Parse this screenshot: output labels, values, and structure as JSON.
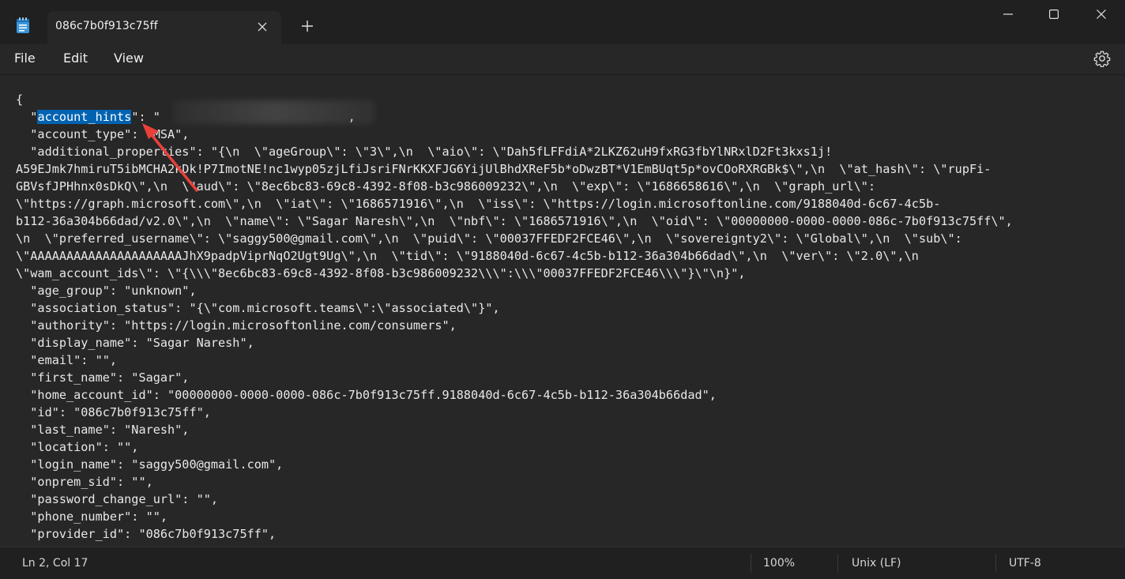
{
  "tab": {
    "title": "086c7b0f913c75ff"
  },
  "menu": [
    "File",
    "Edit",
    "View"
  ],
  "editor": {
    "line1": "{",
    "line2_pre": "  \"",
    "line2_sel": "account_hints",
    "line2_post": "\": \"                          ,",
    "lines": [
      "  \"account_type\": \"MSA\",",
      "  \"additional_properties\": \"{\\n  \\\"ageGroup\\\": \\\"3\\\",\\n  \\\"aio\\\": \\\"Dah5fLFFdiA*2LKZ62uH9fxRG3fbYlNRxlD2Ft3kxs1j!",
      "A59EJmk7hmiruT5ibMCHA2kDk!P7ImotNE!nc1wyp05zjLfiJsriFNrKKXFJG6YijUlBhdXReF5b*oDwzBT*V1EmBUqt5p*ovCOoRXRGBk$\\\",\\n  \\\"at_hash\\\": \\\"rupFi-",
      "GBVsfJPHhnx0sDkQ\\\",\\n  \\\"aud\\\": \\\"8ec6bc83-69c8-4392-8f08-b3c986009232\\\",\\n  \\\"exp\\\": \\\"1686658616\\\",\\n  \\\"graph_url\\\":",
      "\\\"https://graph.microsoft.com\\\",\\n  \\\"iat\\\": \\\"1686571916\\\",\\n  \\\"iss\\\": \\\"https://login.microsoftonline.com/9188040d-6c67-4c5b-",
      "b112-36a304b66dad/v2.0\\\",\\n  \\\"name\\\": \\\"Sagar Naresh\\\",\\n  \\\"nbf\\\": \\\"1686571916\\\",\\n  \\\"oid\\\": \\\"00000000-0000-0000-086c-7b0f913c75ff\\\",",
      "\\n  \\\"preferred_username\\\": \\\"saggy500@gmail.com\\\",\\n  \\\"puid\\\": \\\"00037FFEDF2FCE46\\\",\\n  \\\"sovereignty2\\\": \\\"Global\\\",\\n  \\\"sub\\\":",
      "\\\"AAAAAAAAAAAAAAAAAAAAAJhX9padpViprNqO2Ugt9Ug\\\",\\n  \\\"tid\\\": \\\"9188040d-6c67-4c5b-b112-36a304b66dad\\\",\\n  \\\"ver\\\": \\\"2.0\\\",\\n",
      "\\\"wam_account_ids\\\": \\\"{\\\\\\\"8ec6bc83-69c8-4392-8f08-b3c986009232\\\\\\\":\\\\\\\"00037FFEDF2FCE46\\\\\\\"}\\\"\\n}\",",
      "  \"age_group\": \"unknown\",",
      "  \"association_status\": \"{\\\"com.microsoft.teams\\\":\\\"associated\\\"}\",",
      "  \"authority\": \"https://login.microsoftonline.com/consumers\",",
      "  \"display_name\": \"Sagar Naresh\",",
      "  \"email\": \"\",",
      "  \"first_name\": \"Sagar\",",
      "  \"home_account_id\": \"00000000-0000-0000-086c-7b0f913c75ff.9188040d-6c67-4c5b-b112-36a304b66dad\",",
      "  \"id\": \"086c7b0f913c75ff\",",
      "  \"last_name\": \"Naresh\",",
      "  \"location\": \"\",",
      "  \"login_name\": \"saggy500@gmail.com\",",
      "  \"onprem_sid\": \"\",",
      "  \"password_change_url\": \"\",",
      "  \"phone_number\": \"\",",
      "  \"provider_id\": \"086c7b0f913c75ff\","
    ]
  },
  "status": {
    "position": "Ln 2, Col 17",
    "zoom": "100%",
    "line_ending": "Unix (LF)",
    "encoding": "UTF-8"
  },
  "colors": {
    "selection": "#0063b1",
    "arrow": "#e8413a"
  }
}
